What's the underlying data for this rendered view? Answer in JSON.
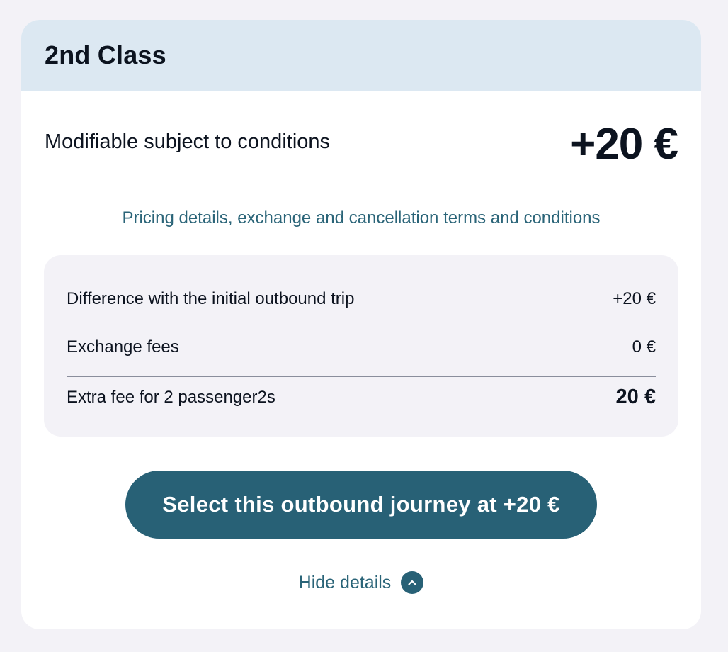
{
  "card": {
    "class_title": "2nd Class",
    "fare_name": "Modifiable subject to conditions",
    "fare_price": "+20 €",
    "terms_link": "Pricing details, exchange and cancellation terms and conditions"
  },
  "details": {
    "rows": [
      {
        "label": "Difference with the initial outbound trip",
        "value": "+20 €"
      },
      {
        "label": "Exchange fees",
        "value": "0 €"
      }
    ],
    "total": {
      "label": "Extra fee for 2 passenger2s",
      "value": "20 €"
    }
  },
  "actions": {
    "select_button": "Select this outbound journey at +20 €",
    "hide_details": "Hide details",
    "hide_icon": "chevron-up-icon"
  },
  "colors": {
    "page_background": "#f3f2f7",
    "header_background": "#dce8f2",
    "accent": "#286176",
    "link": "#2a6478",
    "text": "#0c131f"
  }
}
